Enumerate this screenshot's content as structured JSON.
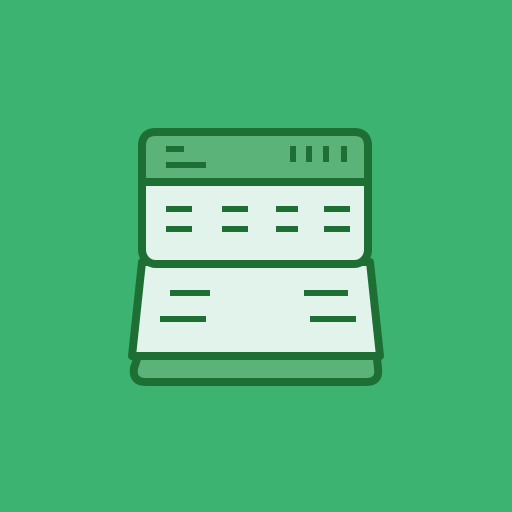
{
  "icon": {
    "name": "spreadsheet-ledger-icon",
    "background_color": "#3cb371",
    "outline_color": "#1e6f33",
    "header_fill": "#5bb37a",
    "body_fill": "#e1f3ea",
    "footer_fill": "#5bb37a"
  }
}
